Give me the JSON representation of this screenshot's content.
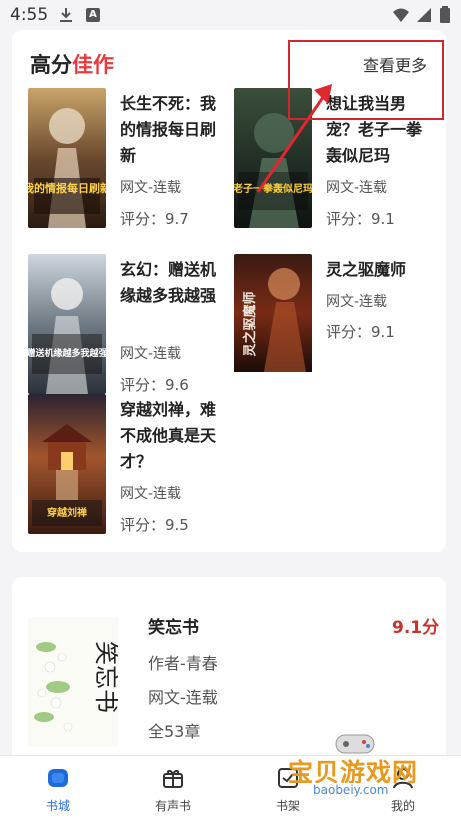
{
  "status_bar": {
    "time": "4:55",
    "a_badge": "A"
  },
  "section": {
    "title_prefix": "高分",
    "title_accent": "佳作",
    "see_more": "查看更多",
    "accent_color": "#e53b3b"
  },
  "books": [
    {
      "title": "长生不死：我的情报每日刷新",
      "tag": "网文-连载",
      "score": "评分：9.7",
      "cover_text": "我的情报每日刷新"
    },
    {
      "title": "想让我当男宠？老子一拳轰似尼玛",
      "tag": "网文-连载",
      "score": "评分：9.1",
      "cover_text": "老子一拳轰似尼玛"
    },
    {
      "title": "玄幻：赠送机缘越多我越强",
      "tag": "网文-连载",
      "score": "评分：9.6",
      "cover_text": "赠送机缘越多我越强"
    },
    {
      "title": "灵之驱魔师",
      "tag": "网文-连载",
      "score": "评分：9.1",
      "cover_text": "灵之驱魔师"
    },
    {
      "title": "穿越刘禅，难不成他真是天才？",
      "tag": "网文-连载",
      "score": "评分：9.5",
      "cover_text": "穿越刘禅"
    }
  ],
  "featured": {
    "title": "笑忘书",
    "score": "9.1分",
    "author": "作者-青春",
    "tag": "网文-连载",
    "chapters": "全53章",
    "cover_text": "笑忘书"
  },
  "tabs": [
    {
      "label": "书城",
      "icon": "bookstore-icon",
      "active": true
    },
    {
      "label": "有声书",
      "icon": "gift-box-icon",
      "active": false
    },
    {
      "label": "书架",
      "icon": "bookshelf-icon",
      "active": false
    },
    {
      "label": "我的",
      "icon": "profile-icon",
      "active": false
    }
  ],
  "watermark": {
    "text": "宝贝游戏网",
    "url": "baobeiy.com"
  }
}
